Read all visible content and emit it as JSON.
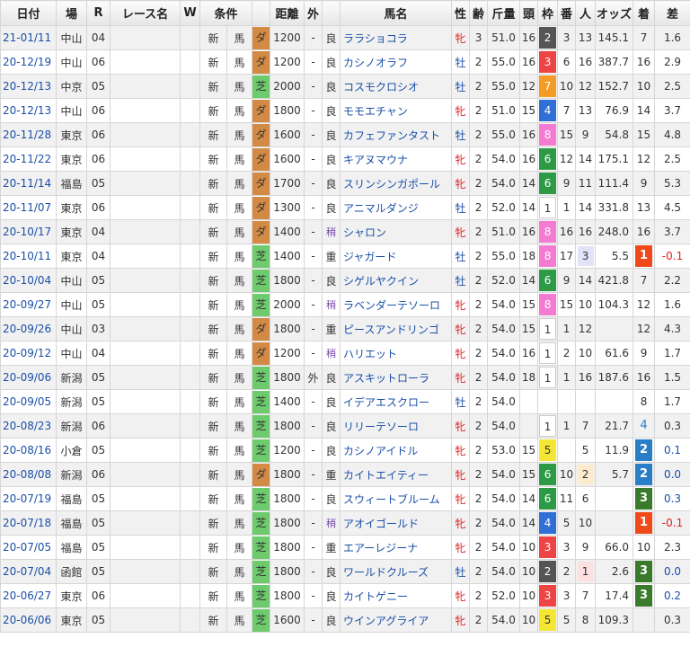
{
  "headers": {
    "date": "日付",
    "place": "場",
    "r": "R",
    "race": "レース名",
    "w": "W",
    "cond": "条件",
    "surf": "",
    "dist": "距離",
    "inout": "外",
    "track": "",
    "horse": "馬名",
    "sex": "性",
    "age": "齢",
    "weight": "斤量",
    "heads": "頭",
    "waku": "枠",
    "num": "番",
    "pop": "人",
    "odds": "オッズ",
    "finish": "着",
    "diff": "差"
  },
  "rows": [
    {
      "date": "21-01/11",
      "place": "中山",
      "r": "04",
      "cond1": "新",
      "cond2": "馬",
      "surf": "ダ",
      "dist": "1200",
      "inout": "-",
      "track": "良",
      "horse": "ララショコラ",
      "sex": "牝",
      "age": "3",
      "weight": "51.0",
      "heads": "16",
      "waku": "2",
      "num": "3",
      "pop": "13",
      "odds": "145.1",
      "finish": "7",
      "diff": "1.6"
    },
    {
      "date": "20-12/19",
      "place": "中山",
      "r": "06",
      "cond1": "新",
      "cond2": "馬",
      "surf": "ダ",
      "dist": "1200",
      "inout": "-",
      "track": "良",
      "horse": "カシノオラフ",
      "sex": "牡",
      "age": "2",
      "weight": "55.0",
      "heads": "16",
      "waku": "3",
      "num": "6",
      "pop": "16",
      "odds": "387.7",
      "finish": "16",
      "diff": "2.9"
    },
    {
      "date": "20-12/13",
      "place": "中京",
      "r": "05",
      "cond1": "新",
      "cond2": "馬",
      "surf": "芝",
      "dist": "2000",
      "inout": "-",
      "track": "良",
      "horse": "コスモクロシオ",
      "sex": "牡",
      "age": "2",
      "weight": "55.0",
      "heads": "12",
      "waku": "7",
      "num": "10",
      "pop": "12",
      "odds": "152.7",
      "finish": "10",
      "diff": "2.5"
    },
    {
      "date": "20-12/13",
      "place": "中山",
      "r": "06",
      "cond1": "新",
      "cond2": "馬",
      "surf": "ダ",
      "dist": "1800",
      "inout": "-",
      "track": "良",
      "horse": "モモエチャン",
      "sex": "牝",
      "age": "2",
      "weight": "51.0",
      "heads": "15",
      "waku": "4",
      "num": "7",
      "pop": "13",
      "odds": "76.9",
      "finish": "14",
      "diff": "3.7"
    },
    {
      "date": "20-11/28",
      "place": "東京",
      "r": "06",
      "cond1": "新",
      "cond2": "馬",
      "surf": "ダ",
      "dist": "1600",
      "inout": "-",
      "track": "良",
      "horse": "カフェファンタスト",
      "sex": "牡",
      "age": "2",
      "weight": "55.0",
      "heads": "16",
      "waku": "8",
      "num": "15",
      "pop": "9",
      "odds": "54.8",
      "finish": "15",
      "diff": "4.8"
    },
    {
      "date": "20-11/22",
      "place": "東京",
      "r": "06",
      "cond1": "新",
      "cond2": "馬",
      "surf": "ダ",
      "dist": "1600",
      "inout": "-",
      "track": "良",
      "horse": "キアヌマウナ",
      "sex": "牝",
      "age": "2",
      "weight": "54.0",
      "heads": "16",
      "waku": "6",
      "num": "12",
      "pop": "14",
      "odds": "175.1",
      "finish": "12",
      "diff": "2.5"
    },
    {
      "date": "20-11/14",
      "place": "福島",
      "r": "05",
      "cond1": "新",
      "cond2": "馬",
      "surf": "ダ",
      "dist": "1700",
      "inout": "-",
      "track": "良",
      "horse": "スリンシンガポール",
      "sex": "牝",
      "age": "2",
      "weight": "54.0",
      "heads": "14",
      "waku": "6",
      "num": "9",
      "pop": "11",
      "odds": "111.4",
      "finish": "9",
      "diff": "5.3"
    },
    {
      "date": "20-11/07",
      "place": "東京",
      "r": "06",
      "cond1": "新",
      "cond2": "馬",
      "surf": "ダ",
      "dist": "1300",
      "inout": "-",
      "track": "良",
      "horse": "アニマルダンジ",
      "sex": "牡",
      "age": "2",
      "weight": "52.0",
      "heads": "14",
      "waku": "1",
      "num": "1",
      "pop": "14",
      "odds": "331.8",
      "finish": "13",
      "diff": "4.5"
    },
    {
      "date": "20-10/17",
      "place": "東京",
      "r": "04",
      "cond1": "新",
      "cond2": "馬",
      "surf": "ダ",
      "dist": "1400",
      "inout": "-",
      "track": "稍",
      "horse": "シャロン",
      "sex": "牝",
      "age": "2",
      "weight": "51.0",
      "heads": "16",
      "waku": "8",
      "num": "16",
      "pop": "16",
      "odds": "248.0",
      "finish": "16",
      "diff": "3.7"
    },
    {
      "date": "20-10/11",
      "place": "東京",
      "r": "04",
      "cond1": "新",
      "cond2": "馬",
      "surf": "芝",
      "dist": "1400",
      "inout": "-",
      "track": "重",
      "horse": "ジャガード",
      "sex": "牡",
      "age": "2",
      "weight": "55.0",
      "heads": "18",
      "waku": "8",
      "num": "17",
      "pop": "3",
      "odds": "5.5",
      "finish": "1",
      "diff": "-0.1"
    },
    {
      "date": "20-10/04",
      "place": "中山",
      "r": "05",
      "cond1": "新",
      "cond2": "馬",
      "surf": "芝",
      "dist": "1800",
      "inout": "-",
      "track": "良",
      "horse": "シゲルヤクイン",
      "sex": "牡",
      "age": "2",
      "weight": "52.0",
      "heads": "14",
      "waku": "6",
      "num": "9",
      "pop": "14",
      "odds": "421.8",
      "finish": "7",
      "diff": "2.2"
    },
    {
      "date": "20-09/27",
      "place": "中山",
      "r": "05",
      "cond1": "新",
      "cond2": "馬",
      "surf": "芝",
      "dist": "2000",
      "inout": "-",
      "track": "稍",
      "horse": "ラベンダーテソーロ",
      "sex": "牝",
      "age": "2",
      "weight": "54.0",
      "heads": "15",
      "waku": "8",
      "num": "15",
      "pop": "10",
      "odds": "104.3",
      "finish": "12",
      "diff": "1.6"
    },
    {
      "date": "20-09/26",
      "place": "中山",
      "r": "03",
      "cond1": "新",
      "cond2": "馬",
      "surf": "ダ",
      "dist": "1800",
      "inout": "-",
      "track": "重",
      "horse": "ピースアンドリンゴ",
      "sex": "牝",
      "age": "2",
      "weight": "54.0",
      "heads": "15",
      "waku": "1",
      "num": "1",
      "pop": "12",
      "odds": "",
      "finish": "12",
      "diff": "4.3"
    },
    {
      "date": "20-09/12",
      "place": "中山",
      "r": "04",
      "cond1": "新",
      "cond2": "馬",
      "surf": "ダ",
      "dist": "1200",
      "inout": "-",
      "track": "稍",
      "horse": "ハリエット",
      "sex": "牝",
      "age": "2",
      "weight": "54.0",
      "heads": "16",
      "waku": "1",
      "num": "2",
      "pop": "10",
      "odds": "61.6",
      "finish": "9",
      "diff": "1.7"
    },
    {
      "date": "20-09/06",
      "place": "新潟",
      "r": "05",
      "cond1": "新",
      "cond2": "馬",
      "surf": "芝",
      "dist": "1800",
      "inout": "外",
      "track": "良",
      "horse": "アスキットローラ",
      "sex": "牝",
      "age": "2",
      "weight": "54.0",
      "heads": "18",
      "waku": "1",
      "num": "1",
      "pop": "16",
      "odds": "187.6",
      "finish": "16",
      "diff": "1.5"
    },
    {
      "date": "20-09/05",
      "place": "新潟",
      "r": "05",
      "cond1": "新",
      "cond2": "馬",
      "surf": "芝",
      "dist": "1400",
      "inout": "-",
      "track": "良",
      "horse": "イデアエスクロー",
      "sex": "牡",
      "age": "2",
      "weight": "54.0",
      "heads": "",
      "waku": "",
      "num": "",
      "pop": "",
      "odds": "",
      "finish": "8",
      "diff": "1.7"
    },
    {
      "date": "20-08/23",
      "place": "新潟",
      "r": "06",
      "cond1": "新",
      "cond2": "馬",
      "surf": "芝",
      "dist": "1800",
      "inout": "-",
      "track": "良",
      "horse": "リリーテソーロ",
      "sex": "牝",
      "age": "2",
      "weight": "54.0",
      "heads": "",
      "waku": "1",
      "num": "1",
      "pop": "7",
      "odds": "21.7",
      "finish": "4",
      "diff": "0.3"
    },
    {
      "date": "20-08/16",
      "place": "小倉",
      "r": "05",
      "cond1": "新",
      "cond2": "馬",
      "surf": "芝",
      "dist": "1200",
      "inout": "-",
      "track": "良",
      "horse": "カシノアイドル",
      "sex": "牝",
      "age": "2",
      "weight": "53.0",
      "heads": "15",
      "waku": "5",
      "num": "",
      "pop": "5",
      "odds": "11.9",
      "finish": "2",
      "diff": "0.1"
    },
    {
      "date": "20-08/08",
      "place": "新潟",
      "r": "06",
      "cond1": "新",
      "cond2": "馬",
      "surf": "ダ",
      "dist": "1800",
      "inout": "-",
      "track": "重",
      "horse": "カイトエイティー",
      "sex": "牝",
      "age": "2",
      "weight": "54.0",
      "heads": "15",
      "waku": "6",
      "num": "10",
      "pop": "2",
      "odds": "5.7",
      "finish": "2",
      "diff": "0.0"
    },
    {
      "date": "20-07/19",
      "place": "福島",
      "r": "05",
      "cond1": "新",
      "cond2": "馬",
      "surf": "芝",
      "dist": "1800",
      "inout": "-",
      "track": "良",
      "horse": "スウィートブルーム",
      "sex": "牝",
      "age": "2",
      "weight": "54.0",
      "heads": "14",
      "waku": "6",
      "num": "11",
      "pop": "6",
      "odds": "",
      "finish": "3",
      "diff": "0.3"
    },
    {
      "date": "20-07/18",
      "place": "福島",
      "r": "05",
      "cond1": "新",
      "cond2": "馬",
      "surf": "芝",
      "dist": "1800",
      "inout": "-",
      "track": "稍",
      "horse": "アオイゴールド",
      "sex": "牝",
      "age": "2",
      "weight": "54.0",
      "heads": "14",
      "waku": "4",
      "num": "5",
      "pop": "10",
      "odds": "",
      "finish": "1",
      "diff": "-0.1"
    },
    {
      "date": "20-07/05",
      "place": "福島",
      "r": "05",
      "cond1": "新",
      "cond2": "馬",
      "surf": "芝",
      "dist": "1800",
      "inout": "-",
      "track": "重",
      "horse": "エアーレジーナ",
      "sex": "牝",
      "age": "2",
      "weight": "54.0",
      "heads": "10",
      "waku": "3",
      "num": "3",
      "pop": "9",
      "odds": "66.0",
      "finish": "10",
      "diff": "2.3"
    },
    {
      "date": "20-07/04",
      "place": "函館",
      "r": "05",
      "cond1": "新",
      "cond2": "馬",
      "surf": "芝",
      "dist": "1800",
      "inout": "-",
      "track": "良",
      "horse": "ワールドクルーズ",
      "sex": "牡",
      "age": "2",
      "weight": "54.0",
      "heads": "10",
      "waku": "2",
      "num": "2",
      "pop": "1",
      "odds": "2.6",
      "finish": "3",
      "diff": "0.0"
    },
    {
      "date": "20-06/27",
      "place": "東京",
      "r": "06",
      "cond1": "新",
      "cond2": "馬",
      "surf": "芝",
      "dist": "1800",
      "inout": "-",
      "track": "良",
      "horse": "カイトゲニー",
      "sex": "牝",
      "age": "2",
      "weight": "52.0",
      "heads": "10",
      "waku": "3",
      "num": "3",
      "pop": "7",
      "odds": "17.4",
      "finish": "3",
      "diff": "0.2"
    },
    {
      "date": "20-06/06",
      "place": "東京",
      "r": "05",
      "cond1": "新",
      "cond2": "馬",
      "surf": "芝",
      "dist": "1600",
      "inout": "-",
      "track": "良",
      "horse": "ウインアグライア",
      "sex": "牝",
      "age": "2",
      "weight": "54.0",
      "heads": "10",
      "waku": "5",
      "num": "5",
      "pop": "8",
      "odds": "109.3",
      "finish": "",
      "diff": "0.3"
    }
  ]
}
